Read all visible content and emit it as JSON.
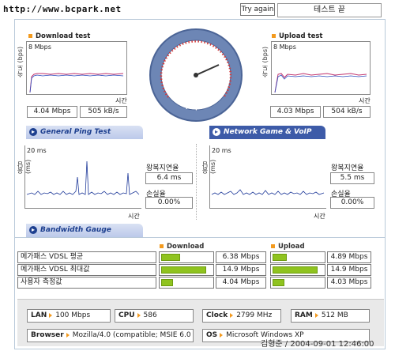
{
  "header": {
    "url": "http://www.bcpark.net",
    "try_again": "Try again",
    "test_end": "테스트 끝"
  },
  "download": {
    "title": "Download test",
    "ylabel": "속도 (bps)",
    "ymax": "8 Mbps",
    "xlabel": "시간",
    "speed_bps": "4.04 Mbps",
    "speed_Bps": "505 kB/s"
  },
  "upload": {
    "title": "Upload test",
    "ylabel": "속도 (bps)",
    "ymax": "8 Mbps",
    "xlabel": "시간",
    "speed_bps": "4.03 Mbps",
    "speed_Bps": "504 kB/s"
  },
  "gauge": {
    "ticks": [
      "2M",
      "4M",
      "6M",
      "8M",
      "10M",
      "12M",
      "14M",
      "16M",
      "18M",
      "20M"
    ],
    "ticks_right": [
      "40M",
      "60M",
      "80M",
      "100M"
    ],
    "label": "MBps"
  },
  "tabs": {
    "general_ping": "General Ping Test",
    "game_voip": "Network Game & VoIP Test",
    "bandwidth": "Bandwidth Gauge"
  },
  "ping_left": {
    "ylabel": "응답 (ms)",
    "ymax": "20 ms",
    "xlabel": "시간",
    "latency_label": "왕복지연율",
    "latency_value": "6.4 ms",
    "loss_label": "손실율",
    "loss_value": "0.00%"
  },
  "ping_right": {
    "ylabel": "응답 (ms)",
    "ymax": "20 ms",
    "xlabel": "시간",
    "latency_label": "왕복지연율",
    "latency_value": "5.5 ms",
    "loss_label": "손실율",
    "loss_value": "0.00%"
  },
  "bandwidth": {
    "download_header": "Download",
    "upload_header": "Upload",
    "rows": [
      {
        "label": "메가패스 VDSL 평균",
        "down": "6.38 Mbps",
        "down_frac": 0.37,
        "up": "4.89 Mbps",
        "up_frac": 0.28
      },
      {
        "label": "메가패스 VDSL 최대값",
        "down": "14.9 Mbps",
        "down_frac": 0.86,
        "up": "14.9 Mbps",
        "up_frac": 0.86
      },
      {
        "label": "사용자 측정값",
        "down": "4.04 Mbps",
        "down_frac": 0.22,
        "up": "4.03 Mbps",
        "up_frac": 0.22
      }
    ]
  },
  "system": {
    "lan_label": "LAN",
    "lan_value": "100 Mbps",
    "cpu_label": "CPU",
    "cpu_value": "586",
    "clock_label": "Clock",
    "clock_value": "2799 MHz",
    "ram_label": "RAM",
    "ram_value": "512 MB",
    "browser_label": "Browser",
    "browser_value": "Mozilla/4.0 (compatible; MSIE 6.0",
    "os_label": "OS",
    "os_value": "Microsoft Windows XP"
  },
  "footer": {
    "signature": "김형준 / 2004-09-01 12:46:00"
  },
  "colors": {
    "accent_orange": "#f39a1e",
    "tab_blue": "#3d5ba8",
    "bar_green": "#8fc31f",
    "ping_line": "#1f3a9a"
  }
}
